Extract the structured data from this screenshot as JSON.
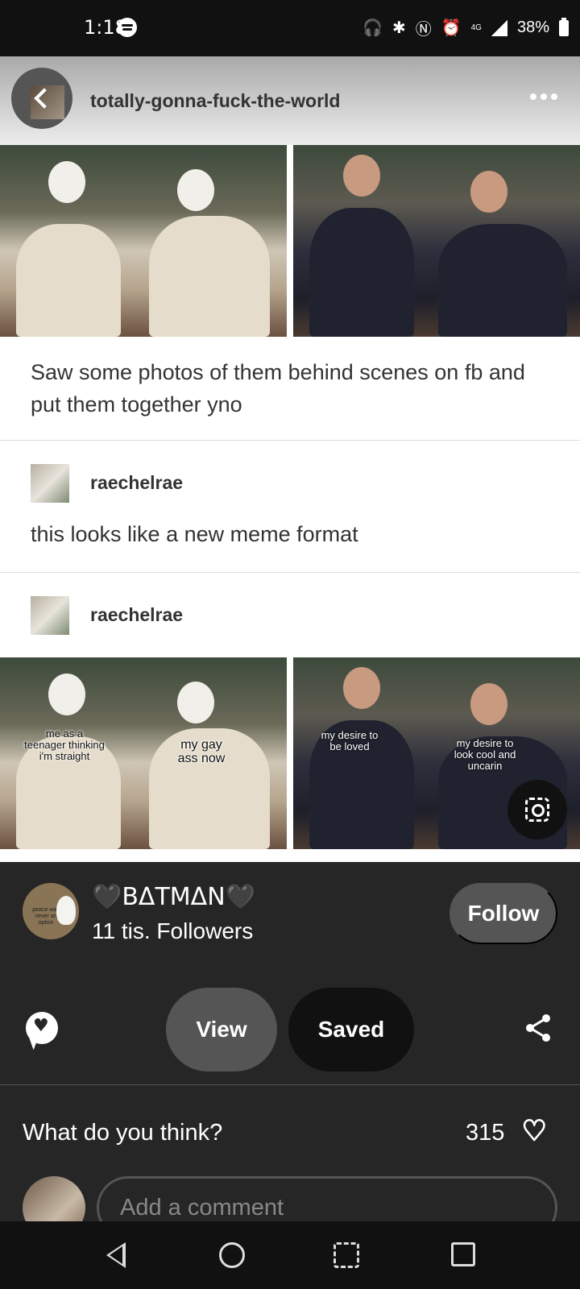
{
  "status_bar": {
    "time": "1:18",
    "signal_label": "4G",
    "battery": "38%"
  },
  "post": {
    "blog_name": "totally-gonna-fuck-the-world",
    "text": "Saw some photos of them behind scenes on fb and put them together yno",
    "reblogs": [
      {
        "username": "raechelrae",
        "text": "this looks like a new meme format"
      },
      {
        "username": "raechelrae"
      }
    ],
    "meme_captions": {
      "left_1": "me as a teenager thinking i'm straight",
      "left_2": "my gay ass now",
      "right_1": "my desire to be loved",
      "right_2": "my desire to look cool and uncarin"
    }
  },
  "author": {
    "avatar_text": "peace was never an option",
    "name": "🖤BΔTMΔN🖤",
    "followers": "11 tis. Followers",
    "follow_label": "Follow"
  },
  "actions": {
    "view_label": "View",
    "saved_label": "Saved"
  },
  "comments": {
    "prompt": "What do you think?",
    "likes": "315",
    "placeholder": "Add a comment"
  },
  "icons": [
    "spotify-icon",
    "back-icon",
    "more-icon",
    "visual-search-icon",
    "chat-icon",
    "share-icon",
    "heart-icon",
    "nav-back-icon",
    "nav-home-icon",
    "nav-capture-icon",
    "nav-recents-icon"
  ]
}
